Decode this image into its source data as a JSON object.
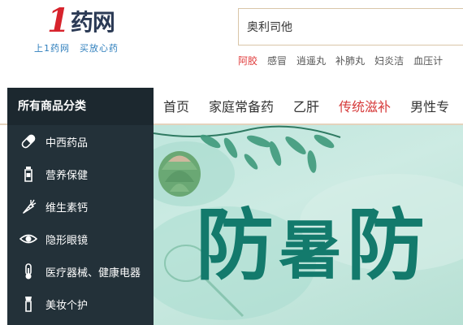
{
  "logo": {
    "text": "1药网",
    "one": "1",
    "rest": "药网",
    "slogan": "上1药网　买放心药"
  },
  "search": {
    "placeholder": "奥利司他"
  },
  "hotwords": [
    {
      "label": "阿胶",
      "hot": true
    },
    {
      "label": "感冒",
      "hot": false
    },
    {
      "label": "逍遥丸",
      "hot": false
    },
    {
      "label": "补肺丸",
      "hot": false
    },
    {
      "label": "妇炎洁",
      "hot": false
    },
    {
      "label": "血压计",
      "hot": false
    }
  ],
  "sidebar": {
    "title": "所有商品分类",
    "items": [
      {
        "label": "中西药品",
        "icon": "pill-icon"
      },
      {
        "label": "营养保健",
        "icon": "bottle-icon"
      },
      {
        "label": "维生素钙",
        "icon": "carrot-icon"
      },
      {
        "label": "隐形眼镜",
        "icon": "eye-icon"
      },
      {
        "label": "医疗器械、健康电器",
        "icon": "thermometer-icon"
      },
      {
        "label": "美妆个护",
        "icon": "cosmetic-icon"
      }
    ]
  },
  "nav": {
    "items": [
      {
        "label": "首页",
        "active": false
      },
      {
        "label": "家庭常备药",
        "active": false
      },
      {
        "label": "乙肝",
        "active": false
      },
      {
        "label": "传统滋补",
        "active": true
      },
      {
        "label": "男性专",
        "active": false
      }
    ]
  },
  "banner": {
    "char1": "防",
    "char2": "暑",
    "char3": "防",
    "colors": {
      "title": "#137a6c",
      "background": "#c3e7de"
    }
  },
  "colors": {
    "brand_red": "#d7232c",
    "sidebar_bg": "#233139",
    "accent_red": "#d63a3a"
  }
}
